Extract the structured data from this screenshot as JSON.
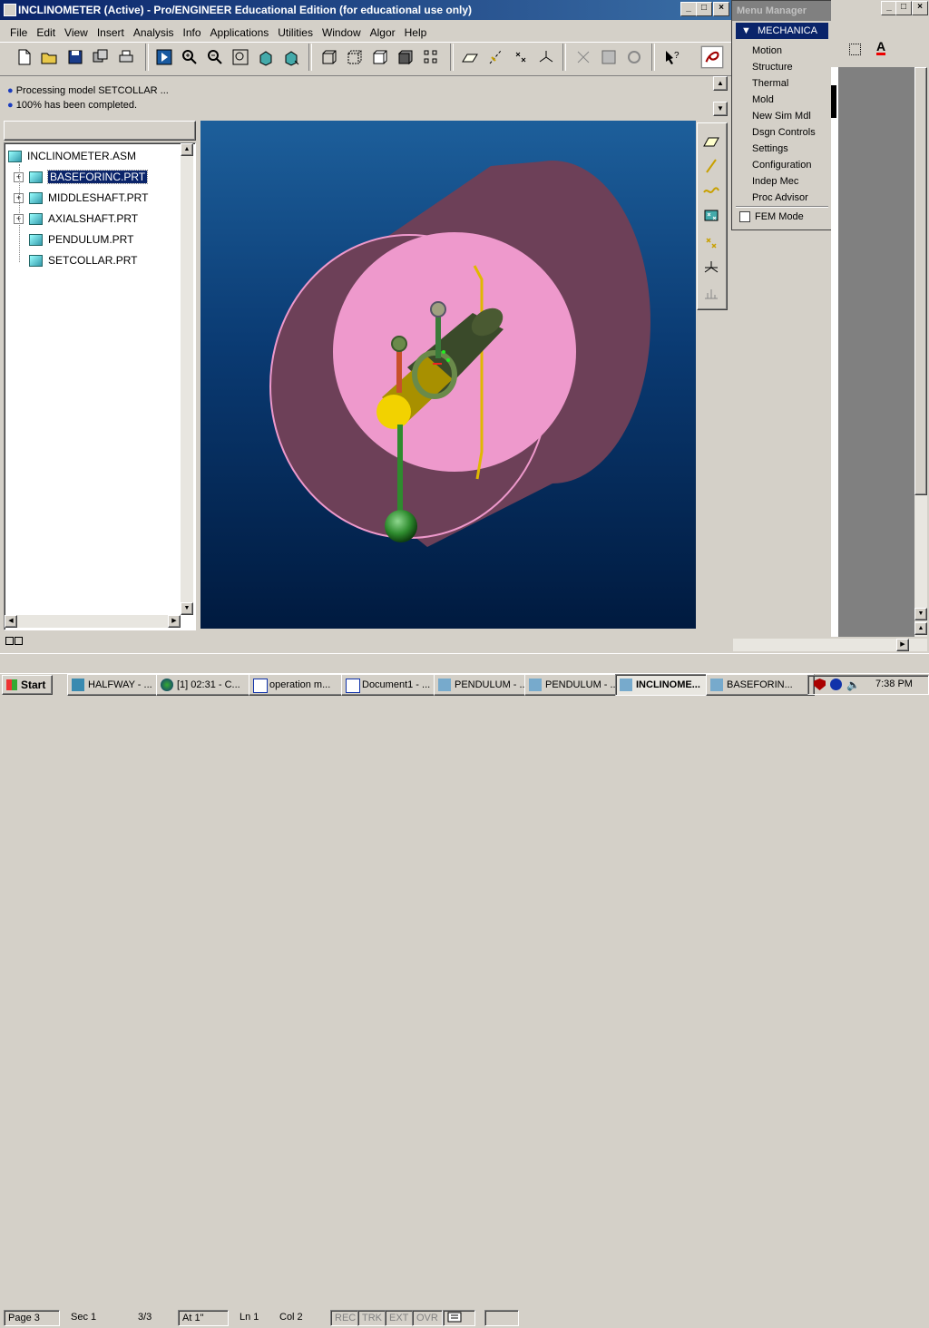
{
  "window": {
    "title": "INCLINOMETER (Active) - Pro/ENGINEER Educational Edition (for educational use only)",
    "min": "_",
    "max": "□",
    "close": "×"
  },
  "menubar": [
    "File",
    "Edit",
    "View",
    "Insert",
    "Analysis",
    "Info",
    "Applications",
    "Utilities",
    "Window",
    "Algor",
    "Help"
  ],
  "messages": [
    "Processing model SETCOLLAR ...",
    "100% has been completed."
  ],
  "tree": {
    "root": "INCLINOMETER.ASM",
    "items": [
      {
        "label": "BASEFORINC.PRT",
        "expandable": true,
        "selected": true
      },
      {
        "label": "MIDDLESHAFT.PRT",
        "expandable": true,
        "selected": false
      },
      {
        "label": "AXIALSHAFT.PRT",
        "expandable": true,
        "selected": false
      },
      {
        "label": "PENDULUM.PRT",
        "expandable": false,
        "selected": false
      },
      {
        "label": "SETCOLLAR.PRT",
        "expandable": false,
        "selected": false
      }
    ]
  },
  "menu_manager": {
    "title": "Menu Manager",
    "header": "MECHANICA",
    "items": [
      "Motion",
      "Structure",
      "Thermal",
      "Mold",
      "New Sim Mdl",
      "Dsgn Controls",
      "Settings",
      "Configuration",
      "Indep Mec",
      "Proc Advisor"
    ],
    "checkbox_label": "FEM Mode"
  },
  "statusbar": {
    "page": "Page  3",
    "sec": "Sec  1",
    "pages": "3/3",
    "at": "At  1\"",
    "ln": "Ln  1",
    "col": "Col  2",
    "rec": "REC",
    "trk": "TRK",
    "ext": "EXT",
    "ovr": "OVR"
  },
  "taskbar": {
    "start": "Start",
    "tasks": [
      "HALFWAY - ...",
      "[1] 02:31 - C...",
      "operation m...",
      "Document1 - ...",
      "PENDULUM - ...",
      "PENDULUM - ...",
      "INCLINOME...",
      "BASEFORIN..."
    ],
    "active_index": 6,
    "clock": "7:38 PM"
  },
  "colors": {
    "title_start": "#0a246a",
    "title_end": "#3a6ea5",
    "viewport_top": "#1d5f9b",
    "viewport_bottom": "#001a3f",
    "cylinder_body": "#6d4058",
    "cylinder_face": "#ee99cc",
    "shaft_dark": "#3a4a2a",
    "shaft_yellow": "#c9b200",
    "pendulum_green": "#2e8b2e",
    "collar_yellow": "#f2d200"
  }
}
